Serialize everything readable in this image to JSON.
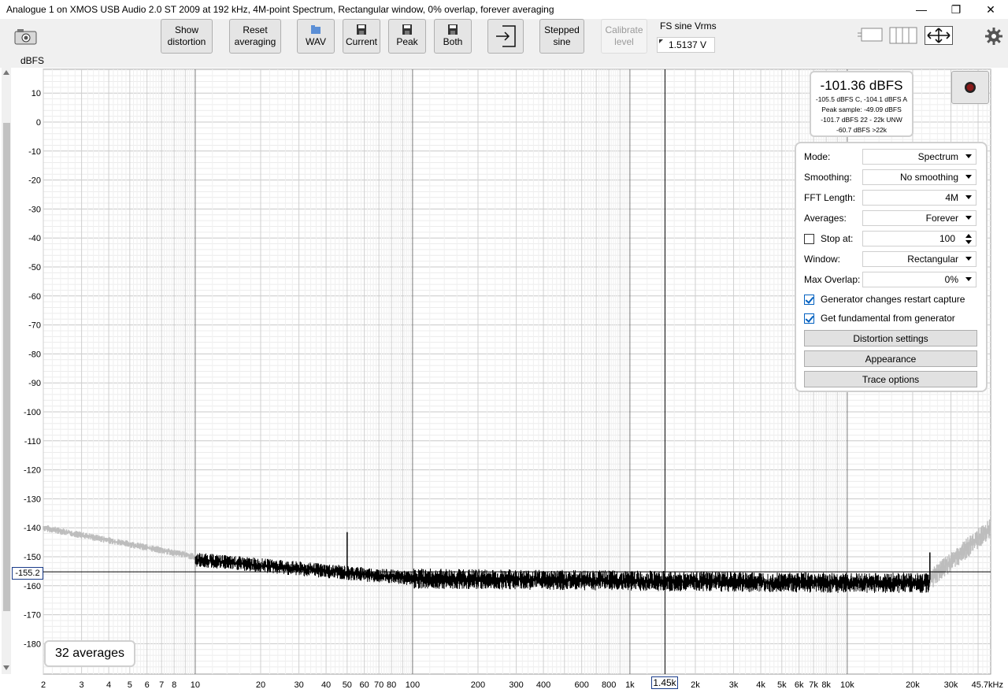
{
  "window": {
    "title": "Analogue 1 on XMOS USB Audio 2.0 ST 2009 at 192 kHz, 4M-point Spectrum, Rectangular window, 0% overlap, forever averaging",
    "controls": [
      "minimize-icon",
      "restore-icon",
      "close-icon"
    ]
  },
  "toolbar": {
    "show_distortion": "Show\ndistortion",
    "reset_averaging": "Reset\naveraging",
    "wav": "WAV",
    "current": "Current",
    "peak": "Peak",
    "both": "Both",
    "stepped_sine": "Stepped\nsine",
    "calibrate_level": "Calibrate\nlevel",
    "fs_label": "FS sine Vrms",
    "fs_value": "1.5137 V"
  },
  "axis": {
    "y_unit": "dBFS",
    "y_ticks": [
      "10",
      "0",
      "-10",
      "-20",
      "-30",
      "-40",
      "-50",
      "-60",
      "-70",
      "-80",
      "-90",
      "-100",
      "-110",
      "-120",
      "-130",
      "-140",
      "-150",
      "-160",
      "-170",
      "-180"
    ],
    "x_ticks": [
      "2",
      "3",
      "4",
      "5",
      "6",
      "7",
      "8",
      "10",
      "20",
      "30",
      "40",
      "50",
      "60",
      "70",
      "80",
      "100",
      "200",
      "300",
      "400",
      "600",
      "800",
      "1k",
      "2k",
      "3k",
      "4k",
      "5k",
      "6k",
      "7k",
      "8k",
      "10k",
      "20k",
      "30k",
      "45.7kHz"
    ],
    "cursor_y": "-155.2",
    "cursor_x": "1.45k"
  },
  "readout": {
    "main": "-101.36 dBFS",
    "line1": "-105.5 dBFS C, -104.1 dBFS A",
    "line2": "Peak sample: -49.09 dBFS",
    "line3": "-101.7 dBFS 22 - 22k UNW",
    "line4": "-60.7 dBFS >22k"
  },
  "averages_badge": "32 averages",
  "settings": {
    "mode_label": "Mode:",
    "mode_value": "Spectrum",
    "smoothing_label": "Smoothing:",
    "smoothing_value": "No smoothing",
    "fft_label": "FFT Length:",
    "fft_value": "4M",
    "averages_label": "Averages:",
    "averages_value": "Forever",
    "stop_label": "Stop at:",
    "stop_value": "100",
    "window_label": "Window:",
    "window_value": "Rectangular",
    "overlap_label": "Max Overlap:",
    "overlap_value": "0%",
    "gen_restart": "Generator changes restart capture",
    "gen_fundamental": "Get fundamental from generator",
    "distortion_settings": "Distortion settings",
    "appearance": "Appearance",
    "trace_options": "Trace options"
  },
  "colors": {
    "trace": "#000000",
    "trace_outside": "#bdbdbd",
    "record": "#8b1a1a",
    "grid": "#e3e3e3",
    "grid_major": "#8a8a8a"
  }
}
